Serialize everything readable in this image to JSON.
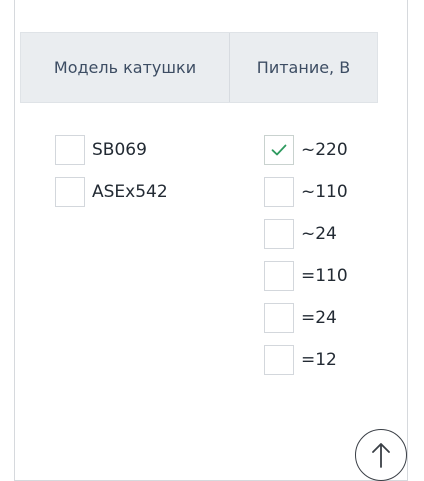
{
  "table": {
    "header": {
      "model": "Модель катушки",
      "power": "Питание, В"
    }
  },
  "models": [
    {
      "label": "SB069",
      "checked": false
    },
    {
      "label": "ASEx542",
      "checked": false
    }
  ],
  "power": [
    {
      "label": "~220",
      "checked": true
    },
    {
      "label": "~110",
      "checked": false
    },
    {
      "label": "~24",
      "checked": false
    },
    {
      "label": "=110",
      "checked": false
    },
    {
      "label": "=24",
      "checked": false
    },
    {
      "label": "=12",
      "checked": false
    }
  ],
  "icons": {
    "check": "check-icon",
    "scroll_top": "arrow-up-icon"
  },
  "colors": {
    "check": "#2e9a5f",
    "header_bg": "#eaedf0",
    "header_text": "#3d4d63"
  }
}
